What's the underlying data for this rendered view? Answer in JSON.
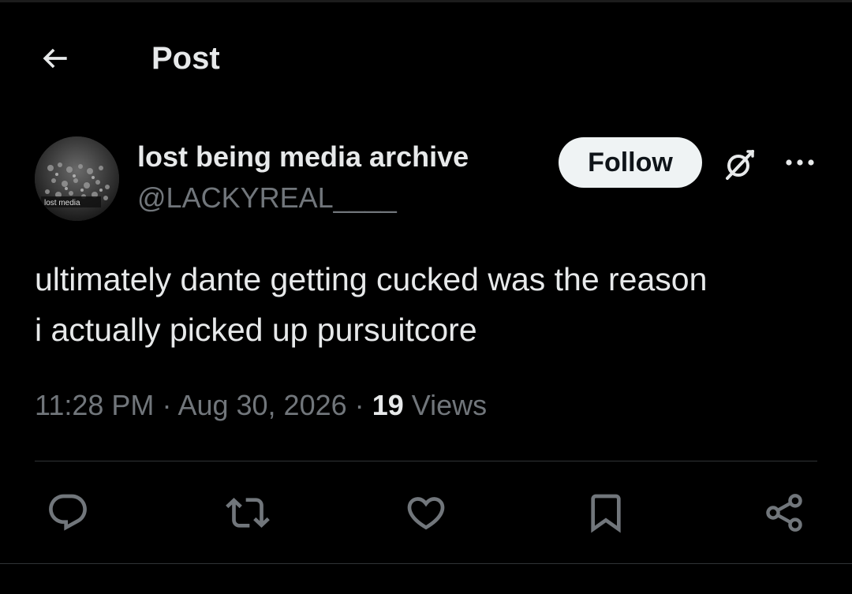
{
  "header": {
    "title": "Post",
    "back_icon": "arrow-left-icon"
  },
  "author": {
    "display_name": "lost being media archive",
    "handle": "@LACKYREAL____",
    "avatar_caption": "lost media",
    "follow_label": "Follow"
  },
  "post": {
    "lines": [
      "ultimately dante getting cucked was the reason",
      "i actually picked up pursuitcore"
    ]
  },
  "meta": {
    "time": "11:28 PM",
    "separator": "·",
    "date": "Aug 30, 2026",
    "views_count": "19",
    "views_label": "Views"
  },
  "actions": {
    "icons": [
      "reply-icon",
      "repost-icon",
      "like-icon",
      "bookmark-icon",
      "share-icon"
    ]
  },
  "colors": {
    "background": "#000000",
    "primary_text": "#e7e9ea",
    "secondary_text": "#71767b",
    "follow_bg": "#eff3f4",
    "divider": "#2f3336"
  }
}
